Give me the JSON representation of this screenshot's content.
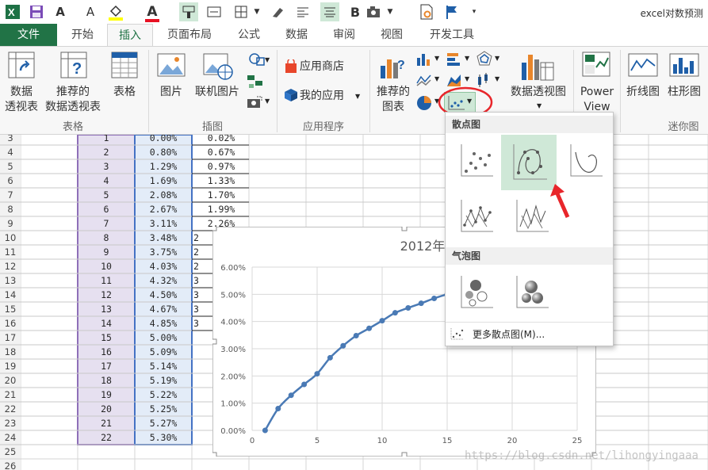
{
  "window": {
    "title": "excel对数预测"
  },
  "tabs": [
    {
      "label": "文件"
    },
    {
      "label": "开始"
    },
    {
      "label": "插入"
    },
    {
      "label": "页面布局"
    },
    {
      "label": "公式"
    },
    {
      "label": "数据"
    },
    {
      "label": "审阅"
    },
    {
      "label": "视图"
    },
    {
      "label": "开发工具"
    }
  ],
  "ribbon": {
    "tables": {
      "pivot": [
        "数据",
        "透视表"
      ],
      "recommended_pivot": [
        "推荐的",
        "数据透视表"
      ],
      "table": "表格",
      "group": "表格"
    },
    "illustrations": {
      "pictures": "图片",
      "online_pictures": "联机图片",
      "group": "插图"
    },
    "apps": {
      "store": "应用商店",
      "my_apps": "我的应用",
      "group": "应用程序"
    },
    "charts": {
      "recommended": [
        "推荐的",
        "图表"
      ],
      "pivot_chart": "数据透视图"
    },
    "power_view": [
      "Power",
      "View"
    ],
    "sparklines": {
      "line": "折线图",
      "column": "柱形图",
      "group": "迷你图"
    }
  },
  "sheet": {
    "row_numbers": [
      "3",
      "4",
      "5",
      "6",
      "7",
      "8",
      "9",
      "10",
      "11",
      "12",
      "13",
      "14",
      "15",
      "16",
      "17",
      "18",
      "19",
      "20",
      "21",
      "22",
      "23",
      "24",
      "25",
      "26"
    ],
    "col_b": [
      "1",
      "2",
      "3",
      "4",
      "5",
      "6",
      "7",
      "8",
      "9",
      "10",
      "11",
      "12",
      "13",
      "14",
      "15",
      "16",
      "17",
      "18",
      "19",
      "20",
      "21",
      "22"
    ],
    "col_c": [
      "0.00%",
      "0.80%",
      "1.29%",
      "1.69%",
      "2.08%",
      "2.67%",
      "3.11%",
      "3.48%",
      "3.75%",
      "4.03%",
      "4.32%",
      "4.50%",
      "4.67%",
      "4.85%",
      "5.00%",
      "5.09%",
      "5.14%",
      "5.19%",
      "5.22%",
      "5.25%",
      "5.27%",
      "5.30%"
    ],
    "col_d": [
      "0.02%",
      "0.67%",
      "0.97%",
      "1.33%",
      "1.70%",
      "1.99%",
      "2.26%",
      "2",
      "2",
      "2",
      "3",
      "3",
      "3",
      "3"
    ]
  },
  "chart_data": {
    "type": "scatter",
    "title": "2012年",
    "x": [
      1,
      2,
      3,
      4,
      5,
      6,
      7,
      8,
      9,
      10,
      11,
      12,
      13,
      14,
      15,
      16,
      17,
      18,
      19,
      20,
      21,
      22
    ],
    "y": [
      0.0,
      0.8,
      1.29,
      1.69,
      2.08,
      2.67,
      3.11,
      3.48,
      3.75,
      4.03,
      4.32,
      4.5,
      4.67,
      4.85,
      5.0,
      5.09,
      5.14,
      5.19,
      5.22,
      5.25,
      5.27,
      5.3
    ],
    "xlim": [
      0,
      25
    ],
    "ylim": [
      0,
      6
    ],
    "x_ticks": [
      "0",
      "5",
      "10",
      "15",
      "20",
      "25"
    ],
    "y_ticks": [
      "0.00%",
      "1.00%",
      "2.00%",
      "3.00%",
      "4.00%",
      "5.00%",
      "6.00%"
    ],
    "series_color": "#4a7ab5",
    "grid": true
  },
  "dropdown": {
    "scatter_header": "散点图",
    "bubble_header": "气泡图",
    "more_link": "更多散点图(M)..."
  },
  "watermark": "https://blog.csdn.net/lihongyingaaa",
  "colors": {
    "accent": "#217346",
    "highlight": "#cfe8d7",
    "annotation": "#e8262b"
  }
}
